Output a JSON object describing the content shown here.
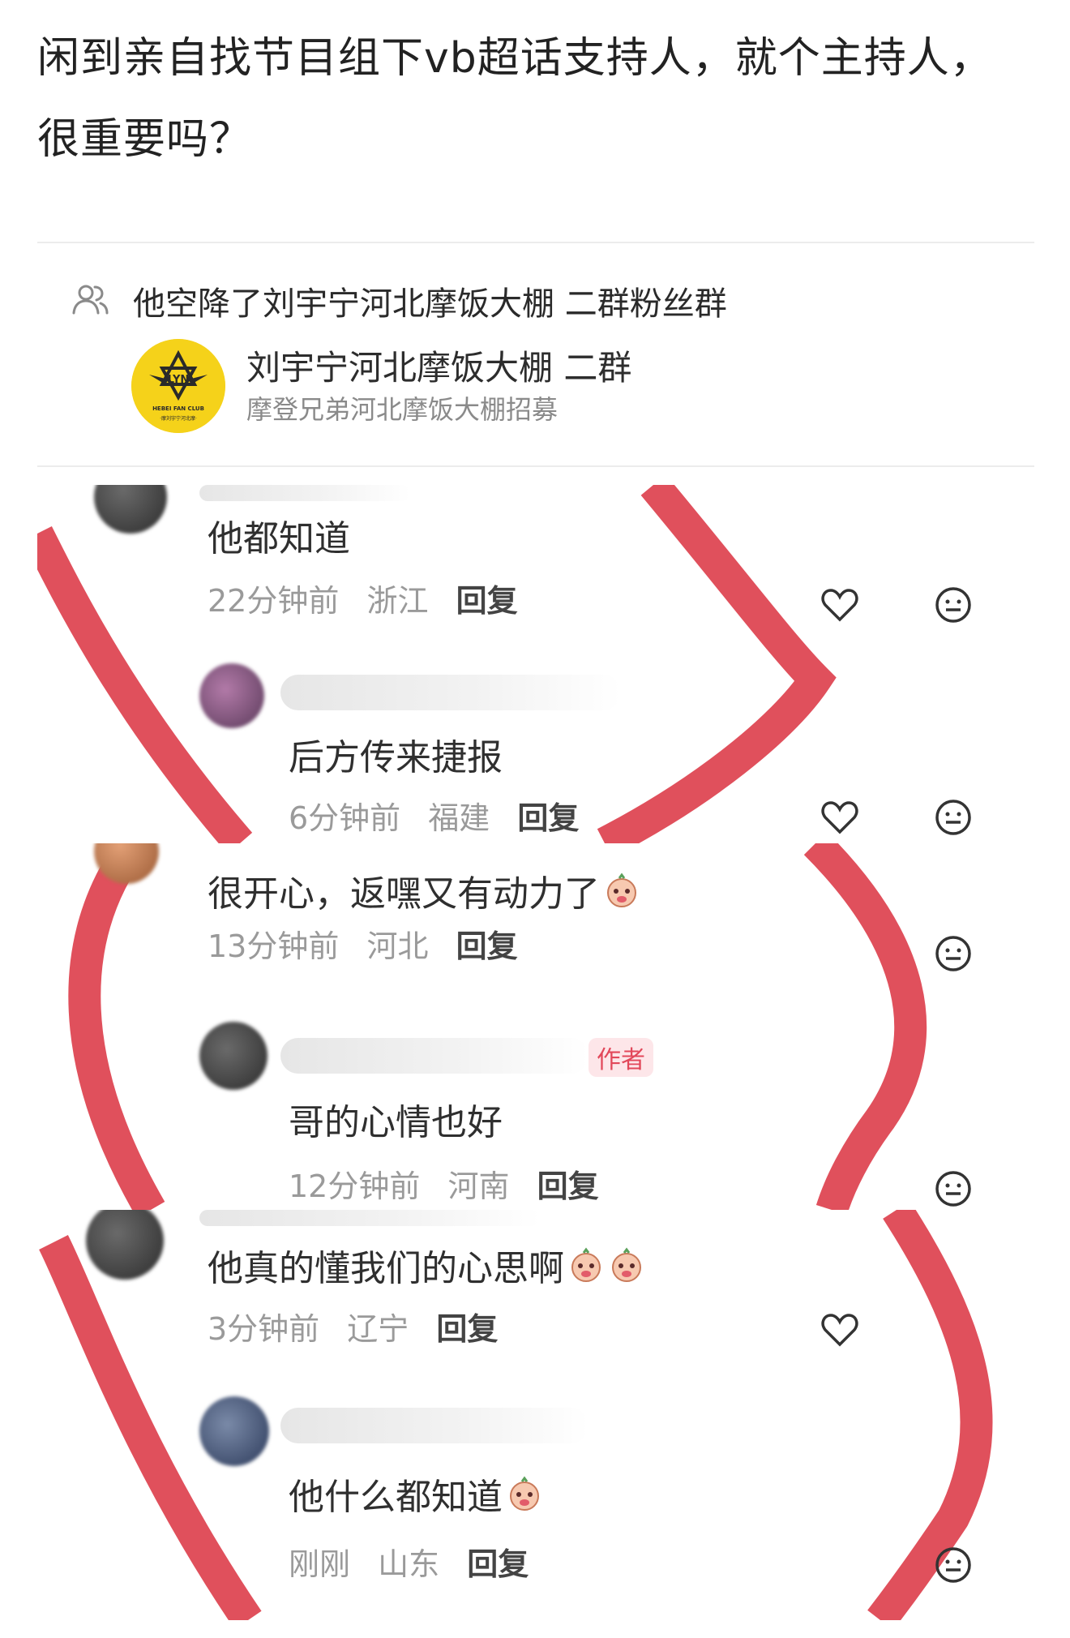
{
  "post": {
    "title": "闲到亲自找节目组下vb超话支持人，就个主持人，很重要吗？"
  },
  "share_card": {
    "group_line": "他空降了刘宇宁河北摩饭大棚 二群粉丝群",
    "group_name": "刘宇宁河北摩饭大棚 二群",
    "group_desc": "摩登兄弟河北摩饭大棚招募",
    "logo_text": "HEBEI FAN CLUB",
    "logo_initials": "LYN",
    "logo_subtext": "·摩刘宇宁河北摩·"
  },
  "colors": {
    "red_decoration": "#e0505c",
    "logo_yellow": "#f5d21a",
    "author_badge": "#e2485a"
  },
  "screenshots": [
    {
      "comments": [
        {
          "text": "他都知道",
          "time": "22分钟前",
          "location": "浙江",
          "reply": "回复",
          "emoji_count": 0,
          "is_author": false
        },
        {
          "text": "后方传来捷报",
          "time": "6分钟前",
          "location": "福建",
          "reply": "回复",
          "emoji_count": 0,
          "is_author": false
        }
      ]
    },
    {
      "comments": [
        {
          "text": "很开心，返嘿又有动力了",
          "time": "13分钟前",
          "location": "河北",
          "reply": "回复",
          "emoji_count": 1,
          "is_author": false
        },
        {
          "text": "哥的心情也好",
          "time": "12分钟前",
          "location": "河南",
          "reply": "回复",
          "emoji_count": 0,
          "is_author": true,
          "author_label": "作者"
        }
      ]
    },
    {
      "comments": [
        {
          "text": "他真的懂我们的心思啊",
          "time": "3分钟前",
          "location": "辽宁",
          "reply": "回复",
          "emoji_count": 2,
          "is_author": false
        },
        {
          "text": "他什么都知道",
          "time": "刚刚",
          "location": "山东",
          "reply": "回复",
          "emoji_count": 1,
          "is_author": false
        }
      ]
    }
  ],
  "icons": {
    "group": "group-people-icon",
    "like": "heart-icon",
    "more": "emoji-face-icon"
  }
}
